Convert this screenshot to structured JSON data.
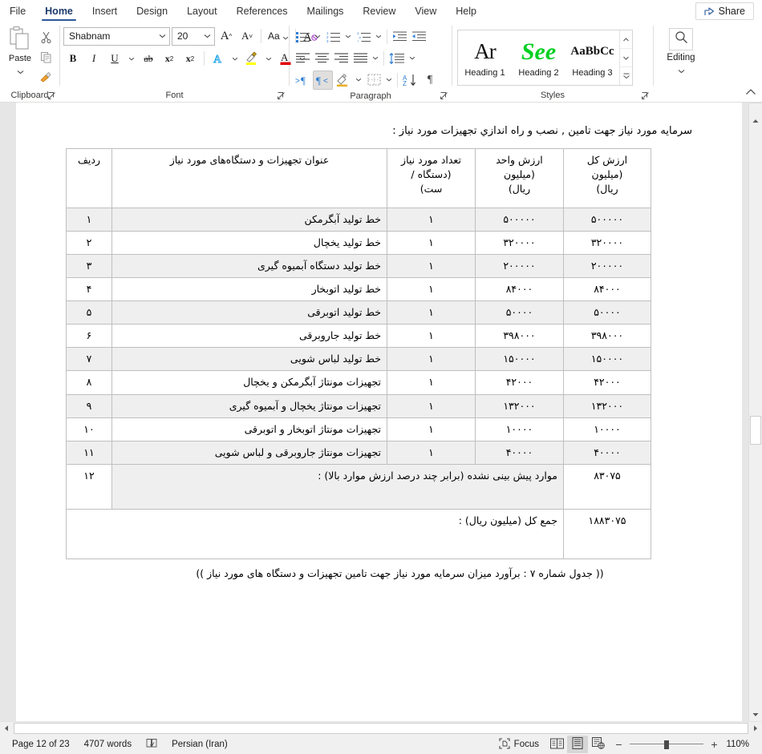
{
  "ribbon_tabs": [
    {
      "label": "File",
      "active": false
    },
    {
      "label": "Home",
      "active": true
    },
    {
      "label": "Insert",
      "active": false
    },
    {
      "label": "Design",
      "active": false
    },
    {
      "label": "Layout",
      "active": false
    },
    {
      "label": "References",
      "active": false
    },
    {
      "label": "Mailings",
      "active": false
    },
    {
      "label": "Review",
      "active": false
    },
    {
      "label": "View",
      "active": false
    },
    {
      "label": "Help",
      "active": false
    }
  ],
  "share": {
    "label": "Share",
    "icon": "share-icon"
  },
  "clipboard": {
    "group_label": "Clipboard",
    "paste_label": "Paste",
    "cut_title": "Cut",
    "copy_title": "Copy",
    "format_painter_title": "Format Painter"
  },
  "font": {
    "group_label": "Font",
    "font_name": "Shabnam",
    "font_size": "20",
    "grow_font": "A",
    "shrink_font": "A",
    "change_case": "Aa",
    "clear_formatting": "A",
    "bold": "B",
    "italic": "I",
    "underline": "U",
    "strikethrough": "ab",
    "subscript": "x",
    "subscript_sup": "2",
    "superscript": "x",
    "superscript_sup": "2",
    "text_effects": "A",
    "highlight": "A",
    "font_color": "A"
  },
  "paragraph": {
    "group_label": "Paragraph",
    "bullets": "bullets-icon",
    "numbering": "numbering-icon",
    "multilevel": "multilevel-list-icon",
    "decrease_indent": "decrease-indent-icon",
    "increase_indent": "increase-indent-icon",
    "align_left": "align-left-icon",
    "align_center": "align-center-icon",
    "align_right": "align-right-icon",
    "justify": "justify-icon",
    "line_spacing": "line-spacing-icon",
    "ltr_text": "ltr-text-direction-icon",
    "rtl_text": "rtl-text-direction-icon",
    "shading": "shading-icon",
    "borders": "borders-icon",
    "sort": "sort-icon",
    "show_marks": "show-formatting-marks-icon"
  },
  "styles": {
    "group_label": "Styles",
    "items": [
      {
        "name": "Heading 1",
        "preview": "Ar"
      },
      {
        "name": "Heading 2",
        "preview": "See"
      },
      {
        "name": "Heading 3",
        "preview": "AaBbCc"
      }
    ]
  },
  "editing": {
    "group_label": "Editing",
    "label": "Editing",
    "icon": "magnifier-icon"
  },
  "document": {
    "heading": "سرمايه مورد نياز جهت تامين , نصب و راه اندازي تجهيزات مورد نياز :",
    "caption": "(( جدول شماره ۷ : برآورد ميزان سرمايه مورد نياز جهت تامين تجهيزات و دستگاه های مورد نياز ))",
    "table": {
      "headers": {
        "row_no": "رديف",
        "title": "عنوان تجهيزات و دستگاه‌های مورد نياز",
        "qty": "تعداد مورد نياز (دستگاه / ست)",
        "unit_value": "ارزش واحد (ميليون ريال)",
        "total_value": "ارزش کل (ميليون ريال)"
      },
      "header_lines": {
        "qty": [
          "تعداد مورد نياز",
          "(دستگاه /",
          "ست)"
        ],
        "unit_value": [
          "ارزش واحد",
          "(ميليون",
          "ريال)"
        ],
        "total_value": [
          "ارزش کل",
          "(ميليون",
          "ريال)"
        ]
      },
      "rows": [
        {
          "no": "۱",
          "title": "خط توليد آبگرمکن",
          "qty": "۱",
          "unit": "۵۰۰۰۰۰",
          "total": "۵۰۰۰۰۰"
        },
        {
          "no": "۲",
          "title": "خط توليد يخچال",
          "qty": "۱",
          "unit": "۳۲۰۰۰۰",
          "total": "۳۲۰۰۰۰"
        },
        {
          "no": "۳",
          "title": "خط توليد دستگاه آبميوه گيری",
          "qty": "۱",
          "unit": "۲۰۰۰۰۰",
          "total": "۲۰۰۰۰۰"
        },
        {
          "no": "۴",
          "title": "خط توليد اتوبخار",
          "qty": "۱",
          "unit": "۸۴۰۰۰",
          "total": "۸۴۰۰۰"
        },
        {
          "no": "۵",
          "title": "خط توليد اتوبرقی",
          "qty": "۱",
          "unit": "۵۰۰۰۰",
          "total": "۵۰۰۰۰"
        },
        {
          "no": "۶",
          "title": "خط توليد جاروبرقی",
          "qty": "۱",
          "unit": "۳۹۸۰۰۰",
          "total": "۳۹۸۰۰۰"
        },
        {
          "no": "۷",
          "title": "خط توليد لباس شويی",
          "qty": "۱",
          "unit": "۱۵۰۰۰۰",
          "total": "۱۵۰۰۰۰"
        },
        {
          "no": "۸",
          "title": "تجهيزات مونتاژ آبگرمکن و يخچال",
          "qty": "۱",
          "unit": "۴۲۰۰۰",
          "total": "۴۲۰۰۰"
        },
        {
          "no": "۹",
          "title": "تجهيزات مونتاژ يخچال و آبميوه گيری",
          "qty": "۱",
          "unit": "۱۳۲۰۰۰",
          "total": "۱۳۲۰۰۰"
        },
        {
          "no": "۱۰",
          "title": "تجهيزات مونتاژ اتوبخار و اتوبرقی",
          "qty": "۱",
          "unit": "۱۰۰۰۰",
          "total": "۱۰۰۰۰"
        },
        {
          "no": "۱۱",
          "title": "تجهيزات مونتاژ جاروبرقی و لباس شويی",
          "qty": "۱",
          "unit": "۴۰۰۰۰",
          "total": "۴۰۰۰۰"
        }
      ],
      "contingency_row": {
        "no": "۱۲",
        "title": "موارد پيش بينی نشده (برابر چند درصد ارزش موارد بالا) :",
        "total": "۸۳۰۷۵"
      },
      "sum_row": {
        "title": "جمع کل (ميليون ريال) :",
        "total": "۱۸۸۳۰۷۵"
      }
    }
  },
  "status": {
    "page": "Page 12 of 23",
    "words": "4707 words",
    "proofing_icon": "proofing-errors-icon",
    "language": "Persian (Iran)",
    "focus": "Focus",
    "focus_icon": "focus-mode-icon",
    "view_read": "read-mode-icon",
    "view_print": "print-layout-icon",
    "view_web": "web-layout-icon",
    "zoom_out": "−",
    "zoom_in": "+",
    "zoom_level": "110%"
  },
  "colors": {
    "accent": "#2b579a",
    "ribbon_bg": "#ffffff",
    "doc_bg": "#e6e6e6",
    "table_border": "#bfbfbf",
    "shade": "#efefef",
    "status_bg": "#f0f0f0"
  }
}
